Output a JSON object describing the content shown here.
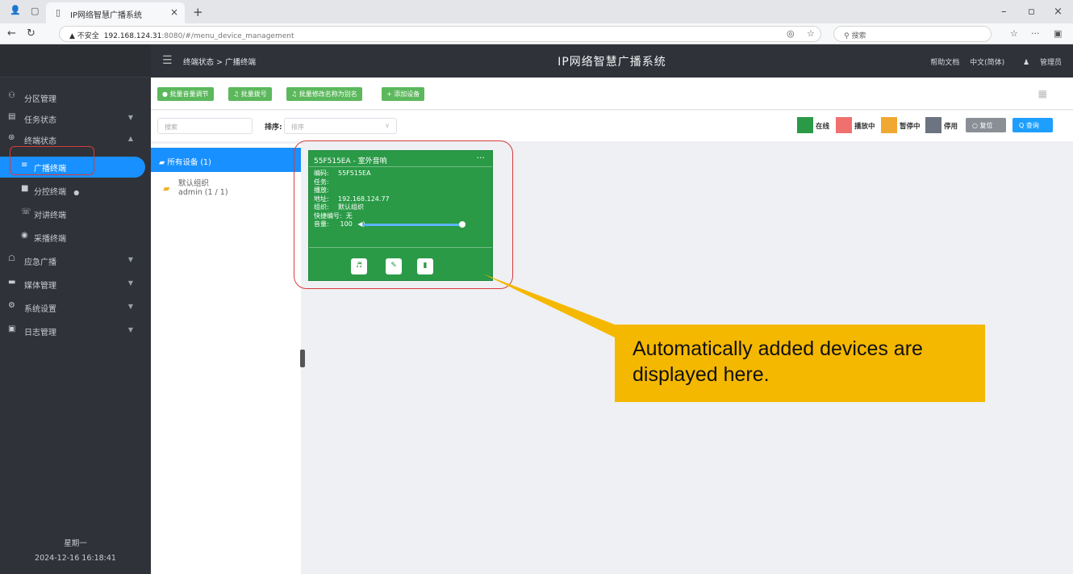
{
  "browser": {
    "tab_title": "IP网络智慧广播系统",
    "tab_close": "×",
    "new_tab": "+",
    "security_warning": "▲ 不安全",
    "url_host": "192.168.124.31",
    "url_path": ":8080/#/menu_device_management",
    "search_placeholder": "搜索"
  },
  "sidebar": {
    "items": [
      {
        "label": "分区管理",
        "icon": "link-icon"
      },
      {
        "label": "任务状态",
        "icon": "list-icon"
      },
      {
        "label": "终端状态",
        "icon": "gear-icon"
      },
      {
        "label": "广播终端",
        "icon": "broadcast-icon"
      },
      {
        "label": "分控终端",
        "icon": "flag-icon"
      },
      {
        "label": "对讲终端",
        "icon": "intercom-icon"
      },
      {
        "label": "采播终端",
        "icon": "record-icon"
      },
      {
        "label": "应急广播",
        "icon": "alert-icon"
      },
      {
        "label": "媒体管理",
        "icon": "media-icon"
      },
      {
        "label": "系统设置",
        "icon": "settings-icon"
      },
      {
        "label": "日志管理",
        "icon": "log-icon"
      }
    ],
    "weekday": "星期一",
    "datetime": "2024-12-16 16:18:41"
  },
  "header": {
    "breadcrumb": "终端状态 > 广播终端",
    "title": "IP网络智慧广播系统",
    "help": "帮助文档",
    "language": "中文(简体)",
    "user": "管理员"
  },
  "toolbar": {
    "buttons": [
      "批量音量调节",
      "批量拨号",
      "批量修改名称为别名",
      "+ 添加设备"
    ]
  },
  "filter": {
    "search_placeholder": "搜索",
    "sort_label": "排序:",
    "sort_placeholder": "排序",
    "legend": [
      {
        "label": "在线",
        "color": "#2a9a46"
      },
      {
        "label": "播放中",
        "color": "#f07070"
      },
      {
        "label": "暂停中",
        "color": "#f0a830"
      },
      {
        "label": "停用",
        "color": "#6b7480"
      }
    ],
    "reset_label": "○ 复位",
    "query_label": "Q 查询"
  },
  "tree": {
    "all_devices": "所有设备 (1)",
    "group_name": "默认组织",
    "group_detail": "admin (1 / 1)"
  },
  "device_card": {
    "title": "55F515EA - 室外音响",
    "more": "···",
    "rows": [
      {
        "key": "编码:",
        "value": "55F515EA"
      },
      {
        "key": "任务:",
        "value": ""
      },
      {
        "key": "播放:",
        "value": ""
      },
      {
        "key": "地址:",
        "value": "192.168.124.77"
      },
      {
        "key": "组织:",
        "value": "默认组织"
      },
      {
        "key": "快捷编号:",
        "value": "无"
      }
    ],
    "volume_label": "音量:",
    "volume_value": "100",
    "volume_level": 1.0
  },
  "annotation": {
    "text": "Automatically added devices are displayed here."
  }
}
